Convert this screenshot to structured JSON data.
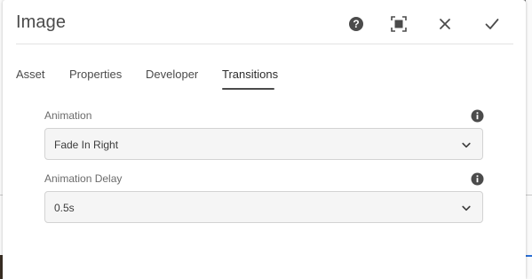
{
  "dialog": {
    "title": "Image",
    "actions": {
      "help_icon": "help-circle-icon",
      "fullscreen_icon": "fullscreen-icon",
      "close_icon": "close-icon",
      "done_icon": "checkmark-icon"
    }
  },
  "tabs": [
    {
      "label": "Asset",
      "active": false
    },
    {
      "label": "Properties",
      "active": false
    },
    {
      "label": "Developer",
      "active": false
    },
    {
      "label": "Transitions",
      "active": true
    }
  ],
  "fields": {
    "animation": {
      "label": "Animation",
      "value": "Fade In Right",
      "info_icon": "info-icon"
    },
    "animation_delay": {
      "label": "Animation Delay",
      "value": "0.5s",
      "info_icon": "info-icon"
    }
  },
  "colors": {
    "icon": "#4b4b4b",
    "text": "#4b4b4b",
    "select_bg": "#f5f5f5",
    "select_border": "#d3d3d3",
    "accent_line": "#2b6fd6"
  }
}
